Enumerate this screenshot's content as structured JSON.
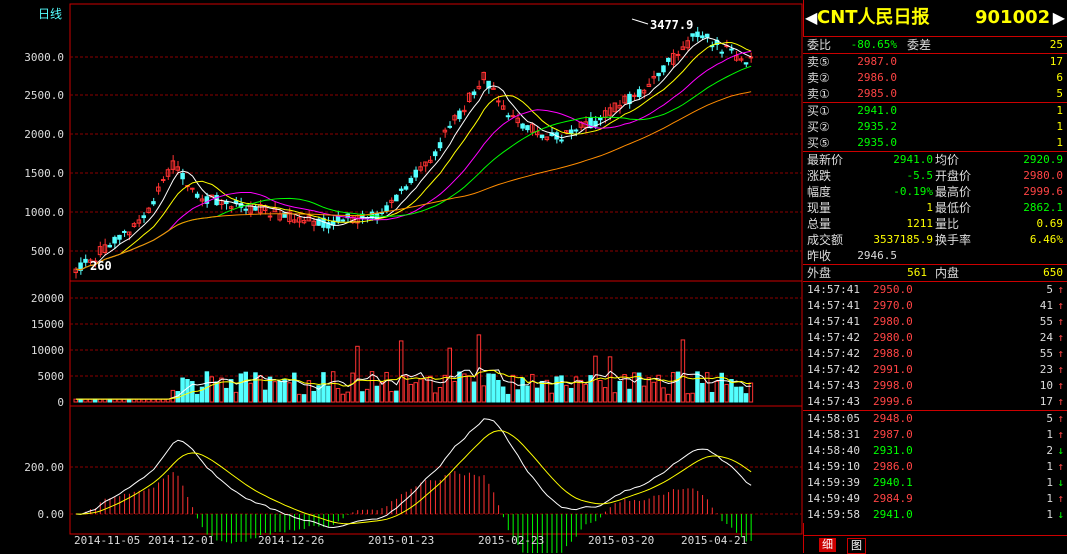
{
  "chart": {
    "period_label": "日线",
    "price_axis": [
      "3000.0",
      "2500.0",
      "2000.0",
      "1500.0",
      "1000.0",
      "500.0"
    ],
    "volume_axis": [
      "20000",
      "15000",
      "10000",
      "5000",
      "0"
    ],
    "macd_axis": [
      "200.00",
      "0.00"
    ],
    "dates": [
      "2014-11-05",
      "2014-12-01",
      "2014-12-26",
      "2015-01-23",
      "2015-02-23",
      "2015-03-20",
      "2015-04-21"
    ],
    "high_label": "3477.9",
    "low_label": "260",
    "colors": {
      "up": "#ff3232",
      "down": "#54ffff",
      "grid": "#8b0000",
      "axis": "#c00000",
      "ma1": "#ffffff",
      "ma2": "#ffff00",
      "ma3": "#ff00ff",
      "ma4": "#00ff00",
      "ma5": "#ff8c00"
    }
  },
  "header": {
    "name": "CNT人民日报",
    "code": "901002",
    "left_arrow": "◀",
    "right_arrow": "▶"
  },
  "bid_ratio": {
    "label1": "委比",
    "value1": "-80.65%",
    "label2": "委差",
    "value2": "25"
  },
  "asks": [
    {
      "label": "卖⑤",
      "price": "2987.0",
      "vol": "17"
    },
    {
      "label": "卖②",
      "price": "2986.0",
      "vol": "6"
    },
    {
      "label": "卖①",
      "price": "2985.0",
      "vol": "5"
    }
  ],
  "bids": [
    {
      "label": "买①",
      "price": "2941.0",
      "vol": "1"
    },
    {
      "label": "买②",
      "price": "2935.2",
      "vol": "1"
    },
    {
      "label": "买⑤",
      "price": "2935.0",
      "vol": "1"
    }
  ],
  "stats": [
    {
      "l1": "最新价",
      "v1": "2941.0",
      "c1": "green",
      "l2": "均价",
      "v2": "2920.9",
      "c2": "green"
    },
    {
      "l1": "涨跌",
      "v1": "-5.5",
      "c1": "green",
      "l2": "开盘价",
      "v2": "2980.0",
      "c2": "red"
    },
    {
      "l1": "幅度",
      "v1": "-0.19%",
      "c1": "green",
      "l2": "最高价",
      "v2": "2999.6",
      "c2": "red"
    },
    {
      "l1": "现量",
      "v1": "1",
      "c1": "yellow",
      "l2": "最低价",
      "v2": "2862.1",
      "c2": "green"
    },
    {
      "l1": "总量",
      "v1": "1211",
      "c1": "yellow",
      "l2": "量比",
      "v2": "0.69",
      "c2": "yellow"
    },
    {
      "l1": "成交额",
      "v1": "3537185.9",
      "c1": "yellow",
      "l2": "换手率",
      "v2": "6.46%",
      "c2": "yellow"
    }
  ],
  "prev_close": {
    "label": "昨收",
    "value": "2946.5"
  },
  "outer_inner": {
    "l1": "外盘",
    "v1": "561",
    "l2": "内盘",
    "v2": "650"
  },
  "trades": [
    {
      "time": "14:57:41",
      "price": "2950.0",
      "pc": "red",
      "vol": "5",
      "dir": "↑",
      "dc": "red"
    },
    {
      "time": "14:57:41",
      "price": "2970.0",
      "pc": "red",
      "vol": "41",
      "dir": "↑",
      "dc": "red"
    },
    {
      "time": "14:57:41",
      "price": "2980.0",
      "pc": "red",
      "vol": "55",
      "dir": "↑",
      "dc": "red"
    },
    {
      "time": "14:57:42",
      "price": "2980.0",
      "pc": "red",
      "vol": "24",
      "dir": "↑",
      "dc": "red"
    },
    {
      "time": "14:57:42",
      "price": "2988.0",
      "pc": "red",
      "vol": "55",
      "dir": "↑",
      "dc": "red"
    },
    {
      "time": "14:57:42",
      "price": "2991.0",
      "pc": "red",
      "vol": "23",
      "dir": "↑",
      "dc": "red"
    },
    {
      "time": "14:57:43",
      "price": "2998.0",
      "pc": "red",
      "vol": "10",
      "dir": "↑",
      "dc": "red"
    },
    {
      "time": "14:57:43",
      "price": "2999.6",
      "pc": "red",
      "vol": "17",
      "dir": "↑",
      "dc": "red"
    },
    {
      "time": "14:58:05",
      "price": "2948.0",
      "pc": "red",
      "vol": "5",
      "dir": "↑",
      "dc": "red"
    },
    {
      "time": "14:58:31",
      "price": "2987.0",
      "pc": "red",
      "vol": "1",
      "dir": "↑",
      "dc": "red"
    },
    {
      "time": "14:58:40",
      "price": "2931.0",
      "pc": "green",
      "vol": "2",
      "dir": "↓",
      "dc": "green"
    },
    {
      "time": "14:59:10",
      "price": "2986.0",
      "pc": "red",
      "vol": "1",
      "dir": "↑",
      "dc": "red"
    },
    {
      "time": "14:59:39",
      "price": "2940.1",
      "pc": "green",
      "vol": "1",
      "dir": "↓",
      "dc": "green"
    },
    {
      "time": "14:59:49",
      "price": "2984.9",
      "pc": "red",
      "vol": "1",
      "dir": "↑",
      "dc": "red"
    },
    {
      "time": "14:59:58",
      "price": "2941.0",
      "pc": "green",
      "vol": "1",
      "dir": "↓",
      "dc": "green"
    }
  ],
  "tabs": {
    "tab1": "细",
    "tab2": "图"
  }
}
